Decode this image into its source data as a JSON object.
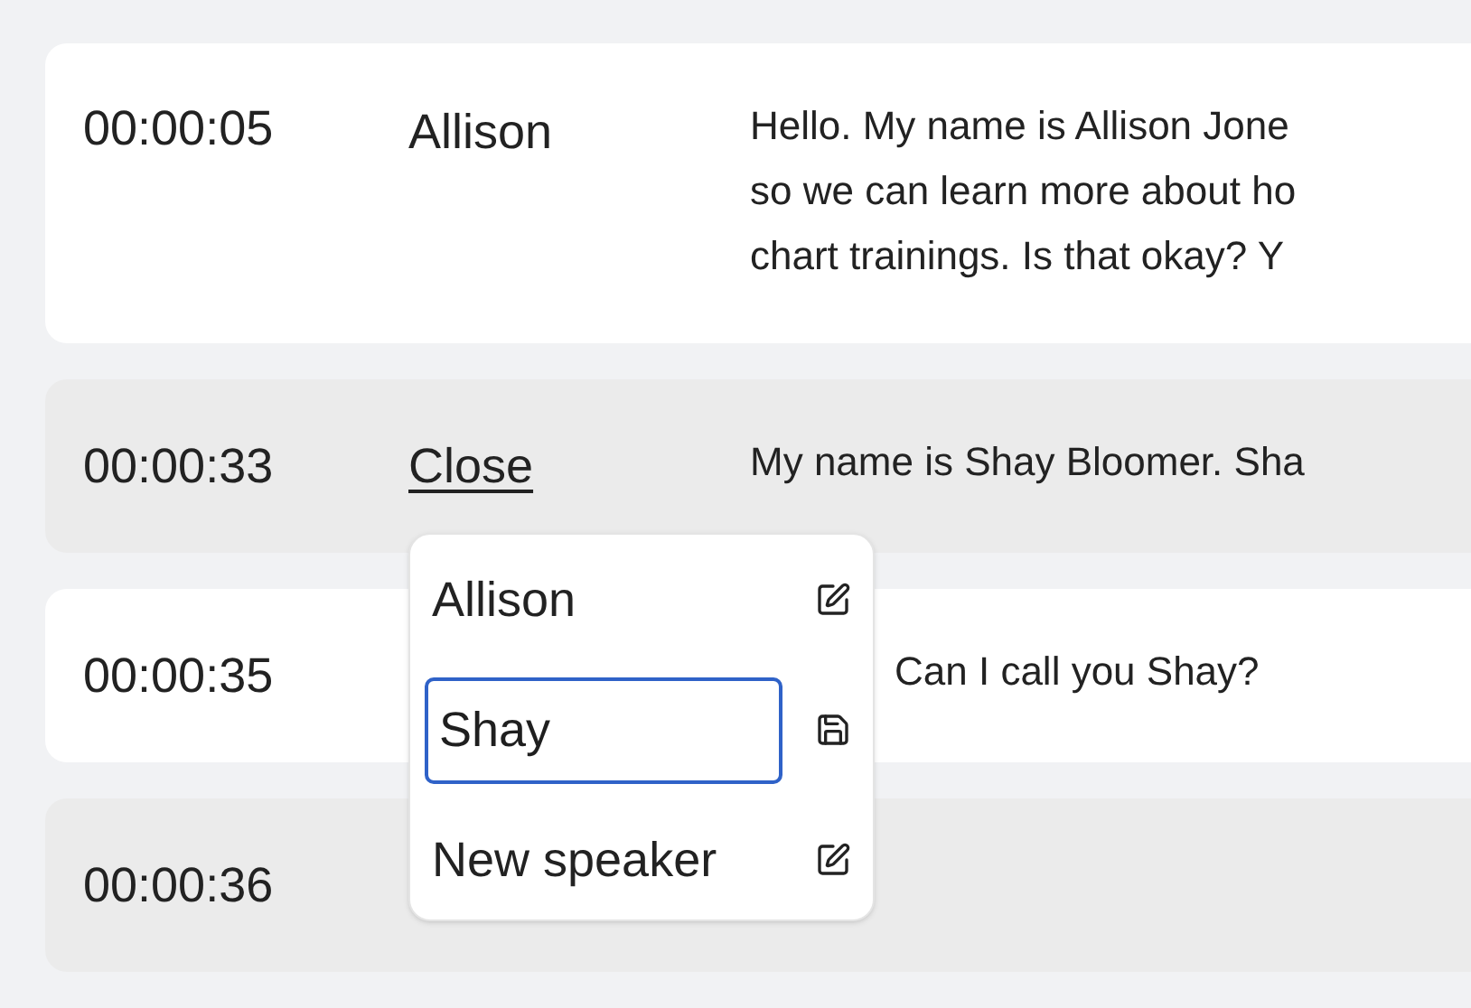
{
  "segments": [
    {
      "time": "00:00:05",
      "speaker": {
        "kind": "name",
        "text": "Allison"
      },
      "lines": [
        "Hello. My name is Allison Jone",
        "so we can learn more about ho",
        "chart trainings. Is that okay? Y"
      ]
    },
    {
      "time": "00:00:33",
      "speaker": {
        "kind": "link",
        "text": "Close"
      },
      "lines": [
        "My name is Shay Bloomer. Sha"
      ]
    },
    {
      "time": "00:00:35",
      "lines": [
        "Can I call you Shay?"
      ]
    },
    {
      "time": "00:00:36"
    }
  ],
  "speaker_menu": {
    "items": [
      {
        "kind": "option",
        "label": "Allison"
      },
      {
        "kind": "editing",
        "value": "Shay"
      },
      {
        "kind": "option",
        "label": "New speaker"
      }
    ]
  }
}
